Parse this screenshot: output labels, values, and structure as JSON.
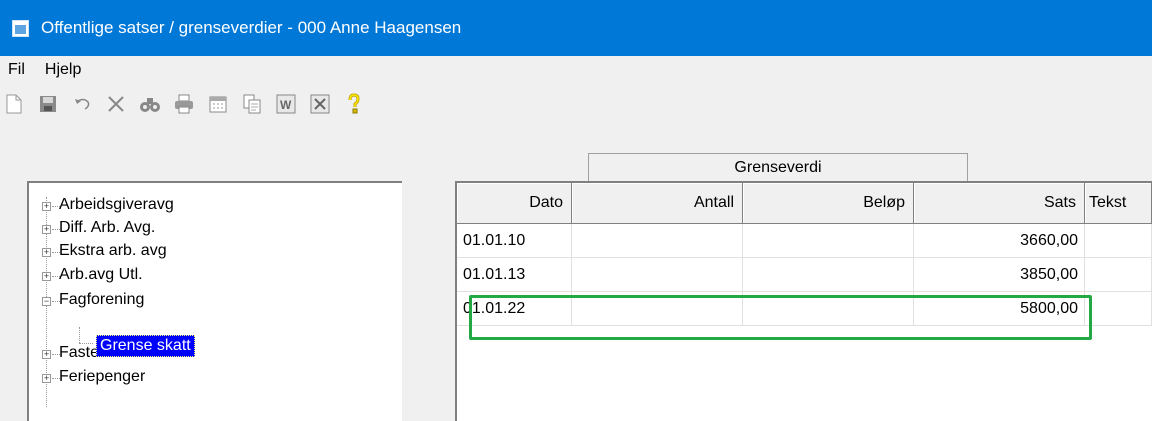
{
  "window": {
    "title": "Offentlige satser / grenseverdier - 000 Anne Haagensen"
  },
  "menu": [
    {
      "label": "Fil"
    },
    {
      "label": "Hjelp"
    }
  ],
  "toolbar": [
    {
      "icon": "new-file-icon"
    },
    {
      "icon": "save-icon"
    },
    {
      "icon": "undo-icon"
    },
    {
      "icon": "delete-icon"
    },
    {
      "icon": "find-icon"
    },
    {
      "icon": "print-icon"
    },
    {
      "icon": "calendar-icon"
    },
    {
      "icon": "copy-icon"
    },
    {
      "icon": "word-export-icon"
    },
    {
      "icon": "excel-export-icon"
    },
    {
      "icon": "help-icon"
    }
  ],
  "tree": {
    "items": [
      {
        "label": "Arbeidsgiveravg",
        "expanded": false
      },
      {
        "label": "Diff. Arb. Avg.",
        "expanded": false
      },
      {
        "label": "Ekstra arb. avg",
        "expanded": false
      },
      {
        "label": "Arb.avg Utl.",
        "expanded": false
      },
      {
        "label": "Fagforening",
        "expanded": true
      },
      {
        "label": "Faste satser",
        "expanded": false
      },
      {
        "label": "Feriepenger",
        "expanded": false
      }
    ],
    "selected_child": {
      "label": "Grense skatt"
    }
  },
  "grid": {
    "group_header": "Grenseverdi",
    "columns": [
      "Dato",
      "Antall",
      "Beløp",
      "Sats",
      "Tekst"
    ],
    "rows": [
      {
        "dato": "01.01.10",
        "antall": "",
        "belop": "",
        "sats": "3660,00",
        "tekst": ""
      },
      {
        "dato": "01.01.13",
        "antall": "",
        "belop": "",
        "sats": "3850,00",
        "tekst": ""
      },
      {
        "dato": "01.01.22",
        "antall": "",
        "belop": "",
        "sats": "5800,00",
        "tekst": ""
      }
    ]
  },
  "colors": {
    "titlebar": "#0078d7",
    "selection": "#0000ff",
    "highlight": "#22a845"
  }
}
